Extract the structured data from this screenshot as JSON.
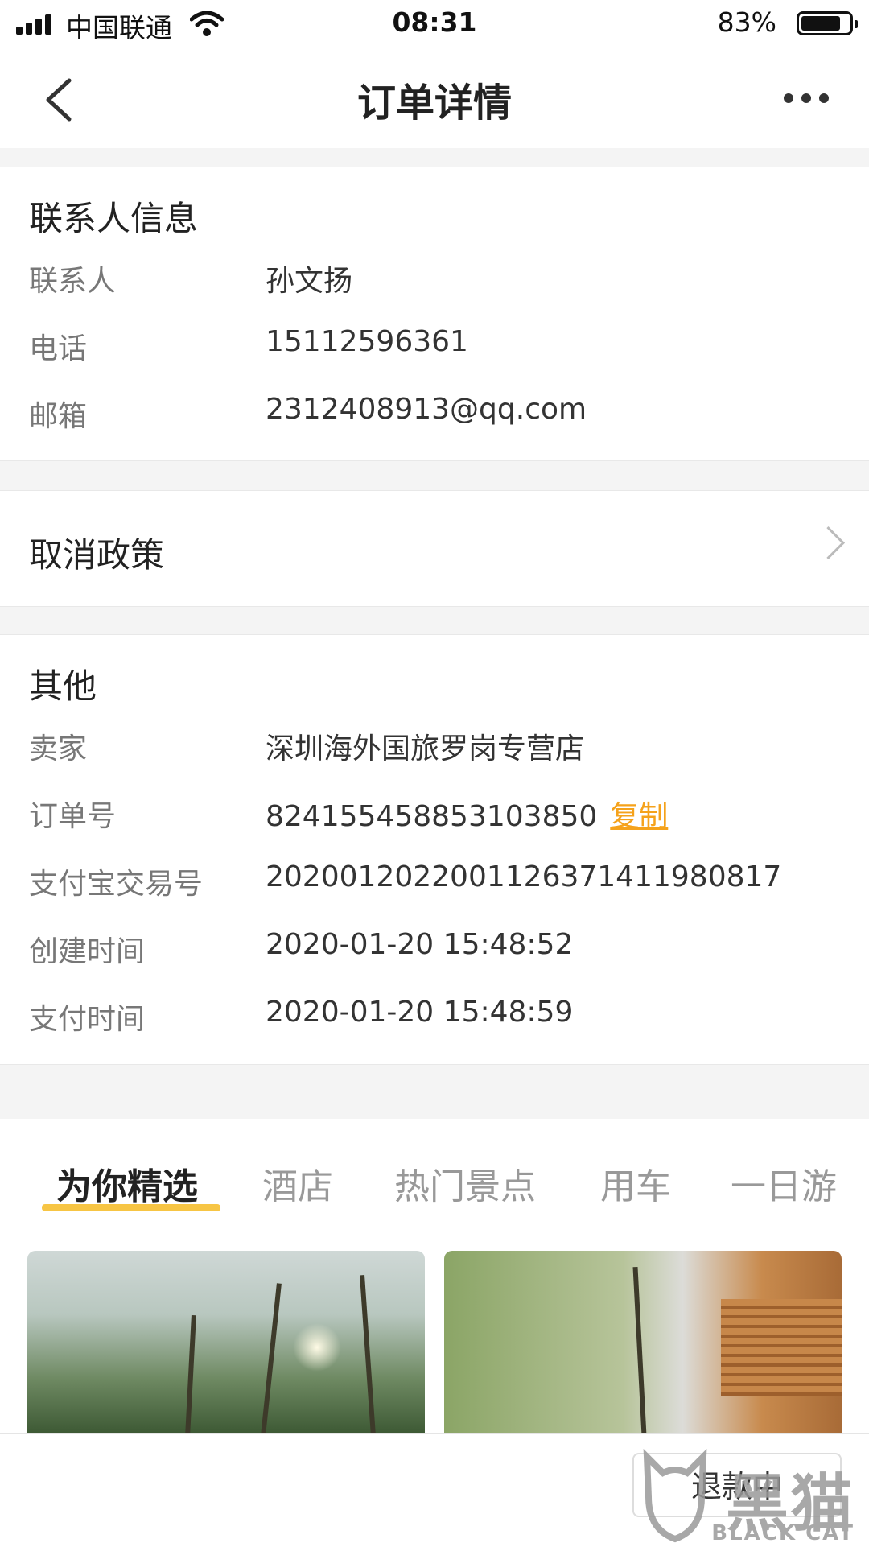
{
  "status_bar": {
    "carrier": "中国联通",
    "time": "08:31",
    "battery": "83%",
    "battery_level": 0.83
  },
  "nav": {
    "title": "订单详情"
  },
  "contact": {
    "title": "联系人信息",
    "rows": [
      {
        "label": "联系人",
        "value": "孙文扬"
      },
      {
        "label": "电话",
        "value": "15112596361"
      },
      {
        "label": "邮箱",
        "value": "2312408913@qq.com"
      }
    ]
  },
  "cancel_policy": {
    "label": "取消政策"
  },
  "other": {
    "title": "其他",
    "rows": [
      {
        "label": "卖家",
        "value": "深圳海外国旅罗岗专营店"
      },
      {
        "label": "订单号",
        "value": "824155458853103850"
      },
      {
        "label": "支付宝交易号",
        "value": "2020012022001126371411980817"
      },
      {
        "label": "创建时间",
        "value": "2020-01-20 15:48:52"
      },
      {
        "label": "支付时间",
        "value": "2020-01-20 15:48:59"
      }
    ],
    "copy_label": "复制"
  },
  "tabs": [
    {
      "label": "为你精选",
      "active": true
    },
    {
      "label": "酒店",
      "active": false
    },
    {
      "label": "热门景点",
      "active": false
    },
    {
      "label": "用车",
      "active": false
    },
    {
      "label": "一日游",
      "active": false
    }
  ],
  "bottom": {
    "refund_button": "退款中"
  },
  "watermark": {
    "chinese": "黑猫",
    "english": "BLACK CAT"
  },
  "colors": {
    "accent_yellow": "#f7c544",
    "link_orange": "#f5a21b"
  }
}
